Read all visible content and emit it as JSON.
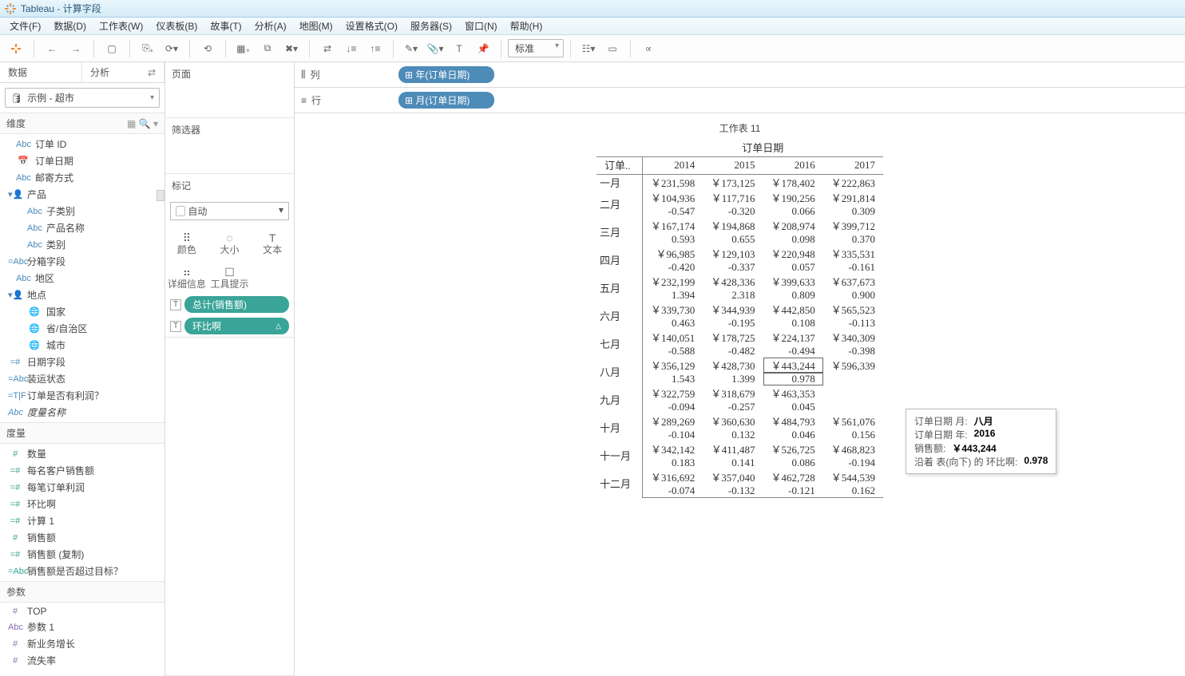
{
  "window_title": "Tableau - 计算字段",
  "menu": [
    "文件(F)",
    "数据(D)",
    "工作表(W)",
    "仪表板(B)",
    "故事(T)",
    "分析(A)",
    "地图(M)",
    "设置格式(O)",
    "服务器(S)",
    "窗口(N)",
    "帮助(H)"
  ],
  "toolbar_fit": "标准",
  "left": {
    "tab_data": "数据",
    "tab_analysis": "分析",
    "datasource": "示例 - 超市",
    "dim_header": "维度",
    "measure_header": "度量",
    "param_header": "参数",
    "dims": [
      {
        "ico": "Abc",
        "txt": "订单 ID",
        "ind": 1
      },
      {
        "ico": "📅",
        "txt": "订单日期",
        "ind": 1
      },
      {
        "ico": "Abc",
        "txt": "邮寄方式",
        "ind": 1
      },
      {
        "ico": "▾👤",
        "txt": "产品",
        "ind": 0
      },
      {
        "ico": "Abc",
        "txt": "子类别",
        "ind": 2
      },
      {
        "ico": "Abc",
        "txt": "产品名称",
        "ind": 2
      },
      {
        "ico": "Abc",
        "txt": "类别",
        "ind": 2
      },
      {
        "ico": "=Abc",
        "txt": "分箱字段",
        "ind": 0
      },
      {
        "ico": "Abc",
        "txt": "地区",
        "ind": 1
      },
      {
        "ico": "▾👤",
        "txt": "地点",
        "ind": 0
      },
      {
        "ico": "🌐",
        "txt": "国家",
        "ind": 2
      },
      {
        "ico": "🌐",
        "txt": "省/自治区",
        "ind": 2
      },
      {
        "ico": "🌐",
        "txt": "城市",
        "ind": 2
      },
      {
        "ico": "=#",
        "txt": "日期字段",
        "ind": 0
      },
      {
        "ico": "=Abc",
        "txt": "装运状态",
        "ind": 0
      },
      {
        "ico": "=T|F",
        "txt": "订单是否有利润？",
        "ind": 0
      },
      {
        "ico": "Abc",
        "txt": "度量名称",
        "ind": 0,
        "italic": true
      }
    ],
    "meas": [
      {
        "ico": "#",
        "txt": "数量"
      },
      {
        "ico": "=#",
        "txt": "每名客户销售额"
      },
      {
        "ico": "=#",
        "txt": "每笔订单利润"
      },
      {
        "ico": "=#",
        "txt": "环比啊"
      },
      {
        "ico": "=#",
        "txt": "计算 1"
      },
      {
        "ico": "#",
        "txt": "销售额"
      },
      {
        "ico": "=#",
        "txt": "销售额 (复制)"
      },
      {
        "ico": "=Abc",
        "txt": "销售额是否超过目标？"
      }
    ],
    "params": [
      {
        "ico": "#",
        "txt": "TOP"
      },
      {
        "ico": "Abc",
        "txt": "参数 1"
      },
      {
        "ico": "#",
        "txt": "新业务增长"
      },
      {
        "ico": "#",
        "txt": "流失率"
      }
    ]
  },
  "mid": {
    "pages": "页面",
    "filters": "筛选器",
    "marks": "标记",
    "auto": "自动",
    "m": {
      "color": "颜色",
      "size": "大小",
      "text": "文本",
      "detail": "详细信息",
      "tooltip": "工具提示"
    },
    "pill1": "总计(销售额)",
    "pill2": "环比啊",
    "pill2_tri": "△"
  },
  "shelves": {
    "cols": "列",
    "rows": "行",
    "colpill": "年(订单日期)",
    "rowpill": "月(订单日期)"
  },
  "viz": {
    "title": "工作表 11",
    "colhdr": "订单日期",
    "rowhdr": "订单..",
    "years": [
      "2014",
      "2015",
      "2016",
      "2017"
    ],
    "rows": [
      {
        "m": "一月",
        "v": [
          "￥231,598",
          "￥173,125",
          "￥178,402",
          "￥222,863"
        ],
        "s": []
      },
      {
        "m": "二月",
        "v": [
          "￥104,936",
          "￥117,716",
          "￥190,256",
          "￥291,814"
        ],
        "s": [
          "-0.547",
          "-0.320",
          "0.066",
          "0.309"
        ]
      },
      {
        "m": "三月",
        "v": [
          "￥167,174",
          "￥194,868",
          "￥208,974",
          "￥399,712"
        ],
        "s": [
          "0.593",
          "0.655",
          "0.098",
          "0.370"
        ]
      },
      {
        "m": "四月",
        "v": [
          "￥96,985",
          "￥129,103",
          "￥220,948",
          "￥335,531"
        ],
        "s": [
          "-0.420",
          "-0.337",
          "0.057",
          "-0.161"
        ]
      },
      {
        "m": "五月",
        "v": [
          "￥232,199",
          "￥428,336",
          "￥399,633",
          "￥637,673"
        ],
        "s": [
          "1.394",
          "2.318",
          "0.809",
          "0.900"
        ]
      },
      {
        "m": "六月",
        "v": [
          "￥339,730",
          "￥344,939",
          "￥442,850",
          "￥565,523"
        ],
        "s": [
          "0.463",
          "-0.195",
          "0.108",
          "-0.113"
        ]
      },
      {
        "m": "七月",
        "v": [
          "￥140,051",
          "￥178,725",
          "￥224,137",
          "￥340,309"
        ],
        "s": [
          "-0.588",
          "-0.482",
          "-0.494",
          "-0.398"
        ]
      },
      {
        "m": "八月",
        "v": [
          "￥356,129",
          "￥428,730",
          "￥443,244",
          "￥596,339"
        ],
        "s": [
          "1.543",
          "1.399",
          "0.978",
          ""
        ],
        "sel": 2
      },
      {
        "m": "九月",
        "v": [
          "￥322,759",
          "￥318,679",
          "￥463,353",
          ""
        ],
        "s": [
          "-0.094",
          "-0.257",
          "0.045",
          ""
        ]
      },
      {
        "m": "十月",
        "v": [
          "￥289,269",
          "￥360,630",
          "￥484,793",
          "￥561,076"
        ],
        "s": [
          "-0.104",
          "0.132",
          "0.046",
          "0.156"
        ]
      },
      {
        "m": "十一月",
        "v": [
          "￥342,142",
          "￥411,487",
          "￥526,725",
          "￥468,823"
        ],
        "s": [
          "0.183",
          "0.141",
          "0.086",
          "-0.194"
        ]
      },
      {
        "m": "十二月",
        "v": [
          "￥316,692",
          "￥357,040",
          "￥462,728",
          "￥544,539"
        ],
        "s": [
          "-0.074",
          "-0.132",
          "-0.121",
          "0.162"
        ]
      }
    ]
  },
  "tooltip": {
    "l1": "订单日期 月:",
    "v1": "八月",
    "l2": "订单日期 年:",
    "v2": "2016",
    "l3": "销售额:",
    "v3": "￥443,244",
    "l4": "沿着 表(向下) 的 环比啊:",
    "v4": "0.978"
  }
}
